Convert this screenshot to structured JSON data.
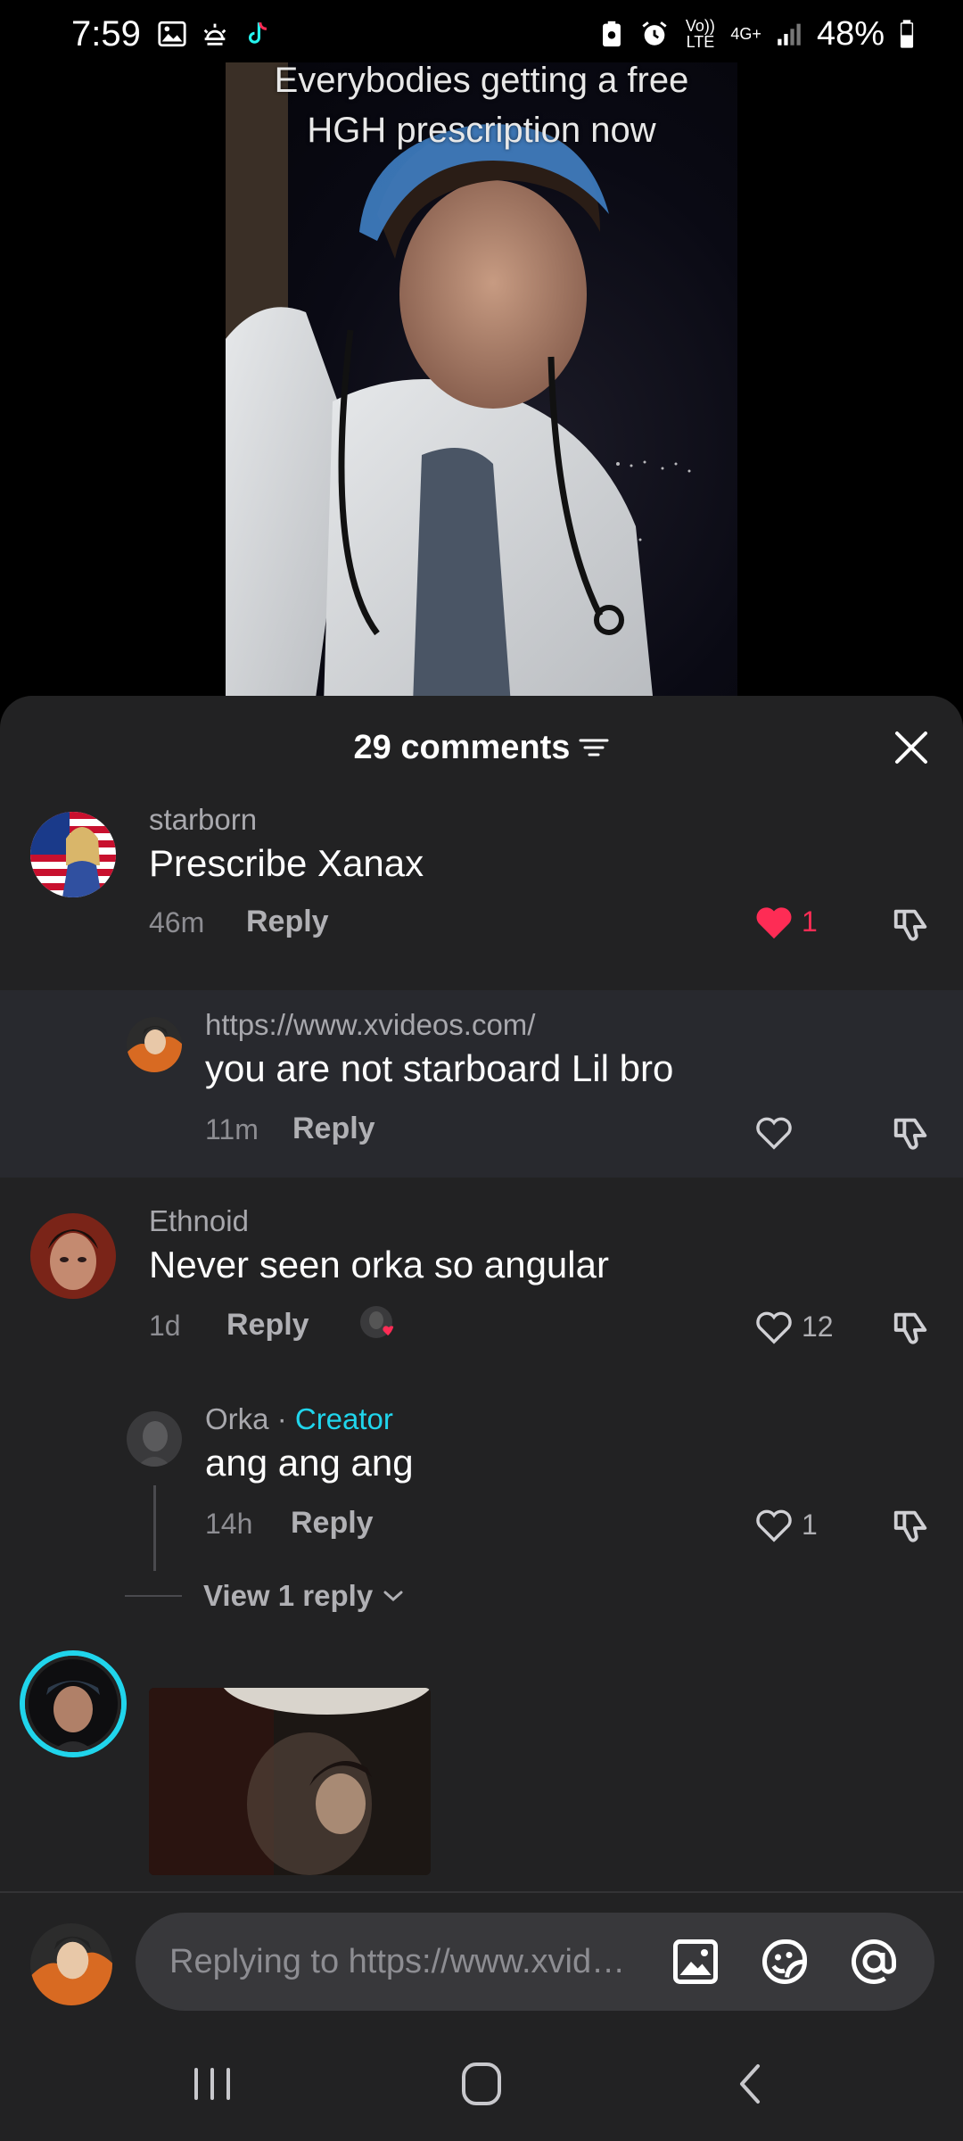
{
  "status_bar": {
    "time": "7:59",
    "battery": "48%",
    "network": "4G+",
    "volte": "Vo)) LTE"
  },
  "video": {
    "caption_line1": "Everybodies getting a free",
    "caption_line2": "HGH prescription now"
  },
  "comments_header": {
    "count_label": "29 comments"
  },
  "comments": [
    {
      "username": "starborn",
      "text": "Prescribe Xanax",
      "time": "46m",
      "reply_label": "Reply",
      "likes": "1",
      "liked": true
    },
    {
      "username": "https://www.xvideos.com/",
      "text": "you are not starboard Lil bro",
      "time": "11m",
      "reply_label": "Reply"
    },
    {
      "username": "Ethnoid",
      "text": "Never seen orka so angular",
      "time": "1d",
      "reply_label": "Reply",
      "likes": "12"
    },
    {
      "username": "Orka",
      "creator_label": "Creator",
      "separator": "·",
      "text": "ang ang ang",
      "time": "14h",
      "reply_label": "Reply",
      "likes": "1"
    }
  ],
  "view_replies": "View 1 reply",
  "input": {
    "placeholder": "Replying to https://www.xvideos.com/"
  },
  "colors": {
    "sheet_bg": "#222223",
    "highlight_bg": "#28292e",
    "like_red": "#fe2c55",
    "creator_cyan": "#20d5ec"
  }
}
